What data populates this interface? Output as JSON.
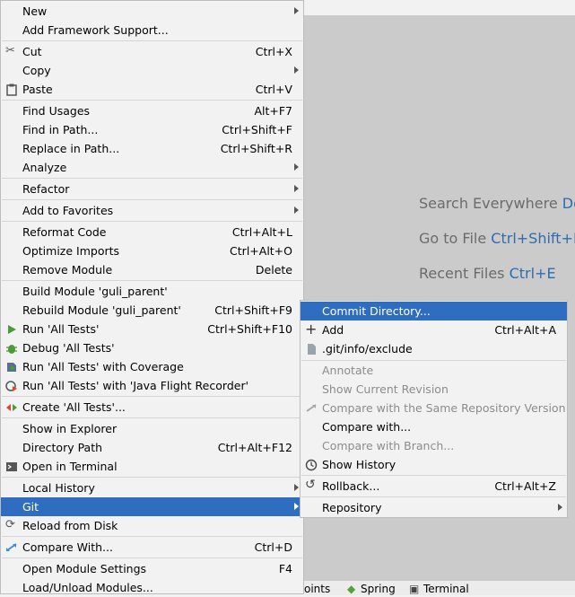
{
  "editor_hints": {
    "search": {
      "text": "Search Everywhere",
      "key": "Dou"
    },
    "goto": {
      "text": "Go to File",
      "key": "Ctrl+Shift+N"
    },
    "recent": {
      "text": "Recent Files",
      "key": "Ctrl+E"
    }
  },
  "bottom_bar": {
    "breakpoints": "oints",
    "spring": "Spring",
    "terminal": "Terminal"
  },
  "context_menu": {
    "new": "New",
    "add_framework": "Add Framework Support...",
    "cut": {
      "label": "Cut",
      "shortcut": "Ctrl+X"
    },
    "copy": "Copy",
    "paste": {
      "label": "Paste",
      "shortcut": "Ctrl+V"
    },
    "find_usages": {
      "label": "Find Usages",
      "shortcut": "Alt+F7"
    },
    "find_in_path": {
      "label": "Find in Path...",
      "shortcut": "Ctrl+Shift+F"
    },
    "replace_in_path": {
      "label": "Replace in Path...",
      "shortcut": "Ctrl+Shift+R"
    },
    "analyze": "Analyze",
    "refactor": "Refactor",
    "add_to_favorites": "Add to Favorites",
    "reformat_code": {
      "label": "Reformat Code",
      "shortcut": "Ctrl+Alt+L"
    },
    "optimize_imports": {
      "label": "Optimize Imports",
      "shortcut": "Ctrl+Alt+O"
    },
    "remove_module": {
      "label": "Remove Module",
      "shortcut": "Delete"
    },
    "build_module": "Build Module 'guli_parent'",
    "rebuild_module": {
      "label": "Rebuild Module 'guli_parent'",
      "shortcut": "Ctrl+Shift+F9"
    },
    "run_tests": {
      "label": "Run 'All Tests'",
      "shortcut": "Ctrl+Shift+F10"
    },
    "debug_tests": "Debug 'All Tests'",
    "run_coverage": "Run 'All Tests' with Coverage",
    "run_jfr": "Run 'All Tests' with 'Java Flight Recorder'",
    "create_tests": "Create 'All Tests'...",
    "show_in_explorer": "Show in Explorer",
    "directory_path": {
      "label": "Directory Path",
      "shortcut": "Ctrl+Alt+F12"
    },
    "open_in_terminal": "Open in Terminal",
    "local_history": "Local History",
    "git": "Git",
    "reload_from_disk": "Reload from Disk",
    "compare_with": {
      "label": "Compare With...",
      "shortcut": "Ctrl+D"
    },
    "open_module_settings": {
      "label": "Open Module Settings",
      "shortcut": "F4"
    },
    "load_unload": "Load/Unload Modules..."
  },
  "git_submenu": {
    "commit_directory": "Commit Directory...",
    "add": {
      "label": "Add",
      "shortcut": "Ctrl+Alt+A"
    },
    "git_exclude": ".git/info/exclude",
    "annotate": "Annotate",
    "show_current_revision": "Show Current Revision",
    "compare_same_repo": "Compare with the Same Repository Version",
    "compare_with": "Compare with...",
    "compare_with_branch": "Compare with Branch...",
    "show_history": "Show History",
    "rollback": {
      "label": "Rollback...",
      "shortcut": "Ctrl+Alt+Z"
    },
    "repository": "Repository"
  },
  "colors": {
    "selection": "#2e6dc0",
    "hint_key": "#2e6dac",
    "editor_bg": "#cbcbcb"
  }
}
